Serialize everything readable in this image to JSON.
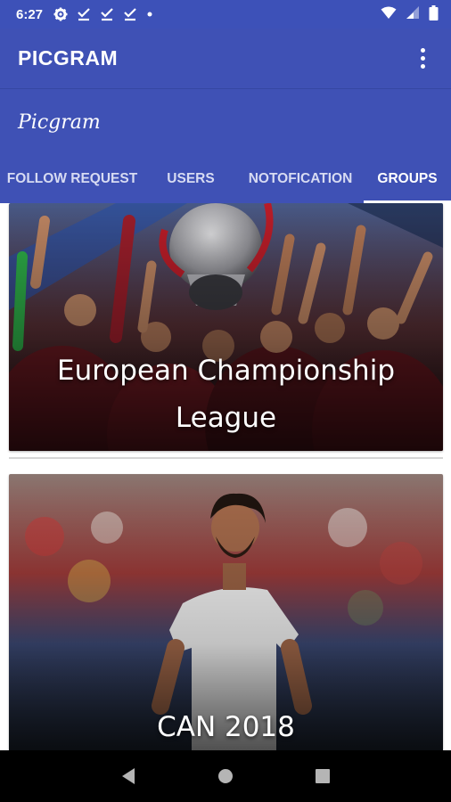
{
  "status_bar": {
    "time": "6:27",
    "icons": [
      "gear-icon",
      "download-done-icon",
      "download-done-icon",
      "download-done-icon",
      "dot-icon",
      "wifi-icon",
      "signal-icon",
      "battery-icon"
    ]
  },
  "app_bar": {
    "title": "PICGRAM",
    "menu_icon": "more-vert-icon"
  },
  "brand": {
    "logo_text": "Picgram"
  },
  "tabs": [
    {
      "label": "FOLLOW REQUEST",
      "active": false
    },
    {
      "label": "USERS",
      "active": false
    },
    {
      "label": "NOTOFICATION",
      "active": false
    },
    {
      "label": "GROUPS",
      "active": true
    }
  ],
  "groups": [
    {
      "line1": "European Championship",
      "line2": "League"
    },
    {
      "line1": "CAN 2018"
    }
  ],
  "nav": {
    "back_icon": "back-icon",
    "home_icon": "home-icon",
    "recents_icon": "recents-icon"
  },
  "colors": {
    "primary": "#3f51b5",
    "status_bar": "#3d51b8",
    "nav_bar": "#000000"
  }
}
